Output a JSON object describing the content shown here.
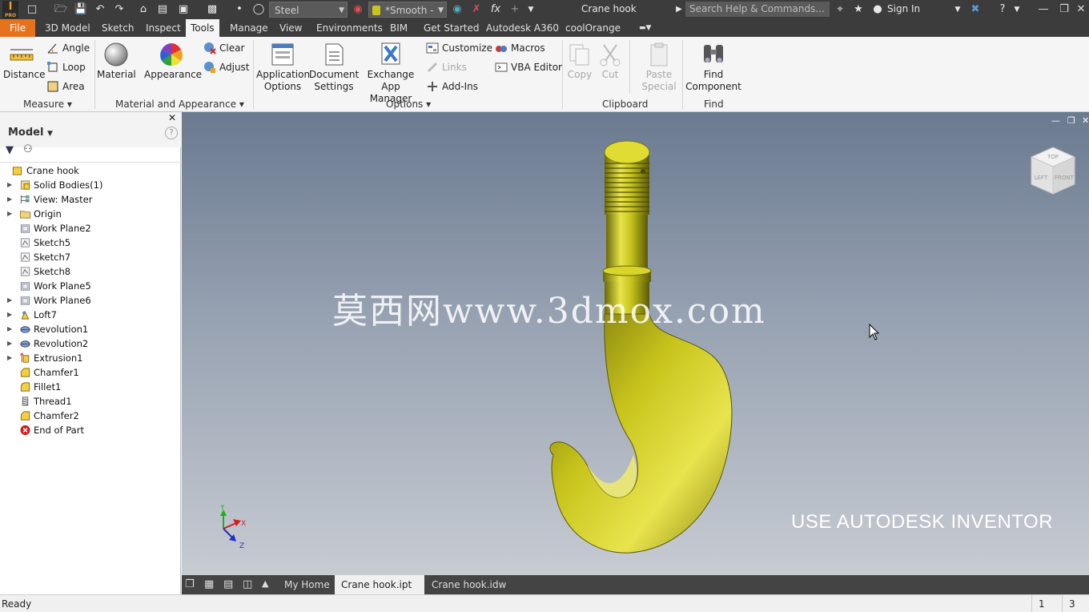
{
  "titlebar": {
    "material": "Steel",
    "appearance": "*Smooth -",
    "document_title": "Crane hook",
    "search_placeholder": "Search Help & Commands...",
    "sign_in": "Sign In"
  },
  "tabs": [
    "File",
    "3D Model",
    "Sketch",
    "Inspect",
    "Tools",
    "Manage",
    "View",
    "Environments",
    "BIM",
    "Get Started",
    "Autodesk A360",
    "coolOrange"
  ],
  "active_tab": "Tools",
  "ribbon": {
    "measure": {
      "distance": "Distance",
      "angle": "Angle",
      "loop": "Loop",
      "area": "Area",
      "label": "Measure"
    },
    "material_appearance": {
      "material": "Material",
      "appearance": "Appearance",
      "clear": "Clear",
      "adjust": "Adjust",
      "label": "Material and Appearance"
    },
    "options": {
      "application_options": [
        "Application",
        "Options"
      ],
      "document_settings": [
        "Document",
        "Settings"
      ],
      "exchange_app_manager": [
        "Exchange",
        "App Manager"
      ],
      "customize": "Customize",
      "links": "Links",
      "add_ins": "Add-Ins",
      "macros": "Macros",
      "vba_editor": "VBA Editor",
      "label": "Options"
    },
    "clipboard": {
      "copy": "Copy",
      "cut": "Cut",
      "paste_special": [
        "Paste",
        "Special"
      ],
      "label": "Clipboard"
    },
    "find": {
      "find_component": [
        "Find",
        "Component"
      ],
      "label": "Find"
    }
  },
  "browser": {
    "title": "Model",
    "items": [
      {
        "label": "Crane hook",
        "icon": "part-icon",
        "expandable": false,
        "root": true
      },
      {
        "label": "Solid Bodies(1)",
        "icon": "solid-bodies-icon",
        "expandable": true
      },
      {
        "label": "View: Master",
        "icon": "view-icon",
        "expandable": true
      },
      {
        "label": "Origin",
        "icon": "folder-icon",
        "expandable": true
      },
      {
        "label": "Work Plane2",
        "icon": "work-plane-icon",
        "expandable": false
      },
      {
        "label": "Sketch5",
        "icon": "sketch-icon",
        "expandable": false
      },
      {
        "label": "Sketch7",
        "icon": "sketch-icon",
        "expandable": false
      },
      {
        "label": "Sketch8",
        "icon": "sketch-icon",
        "expandable": false
      },
      {
        "label": "Work Plane5",
        "icon": "work-plane-icon",
        "expandable": false
      },
      {
        "label": "Work Plane6",
        "icon": "work-plane-icon",
        "expandable": true
      },
      {
        "label": "Loft7",
        "icon": "loft-icon",
        "expandable": true
      },
      {
        "label": "Revolution1",
        "icon": "revolve-icon",
        "expandable": true
      },
      {
        "label": "Revolution2",
        "icon": "revolve-icon",
        "expandable": true
      },
      {
        "label": "Extrusion1",
        "icon": "extrude-icon",
        "expandable": true
      },
      {
        "label": "Chamfer1",
        "icon": "chamfer-icon",
        "expandable": false
      },
      {
        "label": "Fillet1",
        "icon": "fillet-icon",
        "expandable": false
      },
      {
        "label": "Thread1",
        "icon": "thread-icon",
        "expandable": false
      },
      {
        "label": "Chamfer2",
        "icon": "chamfer-icon",
        "expandable": false
      },
      {
        "label": "End of Part",
        "icon": "end-of-part-icon",
        "expandable": false
      }
    ]
  },
  "viewport": {
    "watermark": "莫西网www.3dmox.com",
    "caption": "USE AUTODESK INVENTOR",
    "viewcube_faces": {
      "top": "TOP",
      "left": "LEFT",
      "front": "FRONT"
    },
    "axes": {
      "x": "X",
      "y": "Y",
      "z": "Z"
    },
    "model_color": "#c8c41c"
  },
  "doc_tabs": [
    "My Home",
    "Crane hook.ipt",
    "Crane hook.idw"
  ],
  "active_doc_tab": "Crane hook.ipt",
  "status": {
    "text": "Ready",
    "count1": "1",
    "count2": "3"
  }
}
